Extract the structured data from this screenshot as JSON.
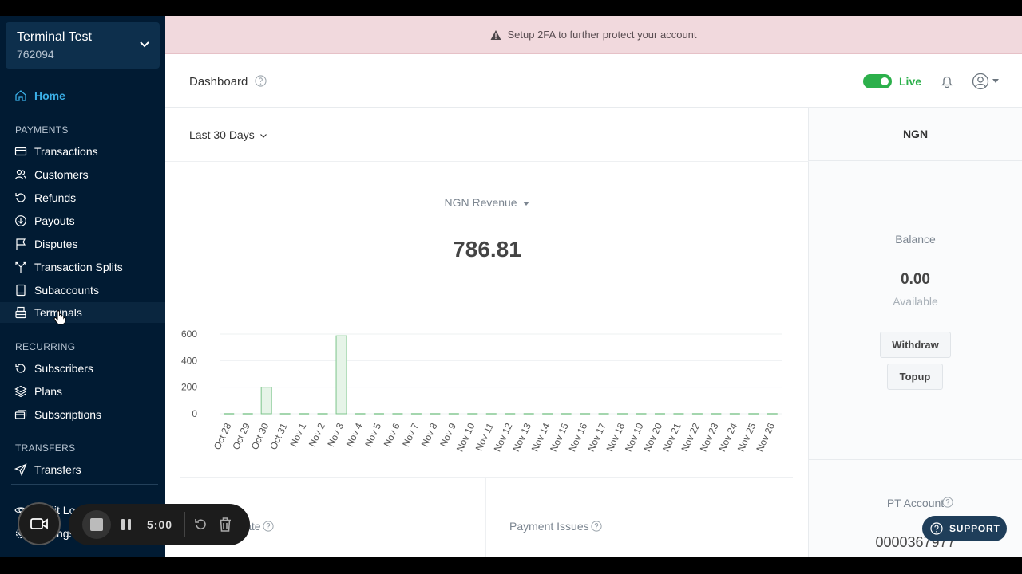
{
  "account": {
    "name": "Terminal Test",
    "id": "762094"
  },
  "sidebar": {
    "home": "Home",
    "payments_label": "PAYMENTS",
    "payments": [
      "Transactions",
      "Customers",
      "Refunds",
      "Payouts",
      "Disputes",
      "Transaction Splits",
      "Subaccounts",
      "Terminals"
    ],
    "recurring_label": "RECURRING",
    "recurring": [
      "Subscribers",
      "Plans",
      "Subscriptions"
    ],
    "transfers_label": "TRANSFERS",
    "transfers": [
      "Transfers"
    ],
    "bottom": [
      "Audit Logs",
      "Settings"
    ]
  },
  "banner": {
    "text": "Setup 2FA to further protect your account"
  },
  "header": {
    "title": "Dashboard",
    "live_label": "Live"
  },
  "main": {
    "range": "Last 30 Days",
    "revenue_label": "NGN Revenue",
    "revenue_value": "786.81",
    "bottom_left_label": "Date",
    "payment_issues": "Payment Issues"
  },
  "right": {
    "currency": "NGN",
    "balance_label": "Balance",
    "balance_value": "0.00",
    "available": "Available",
    "withdraw": "Withdraw",
    "topup": "Topup",
    "pt_account": "PT Account",
    "pt_number": "0000367977"
  },
  "support": "SUPPORT",
  "recorder": {
    "time": "5:00"
  },
  "colors": {
    "sidebar": "#011b33",
    "accent": "#3bb0e8",
    "live": "#2cb04b",
    "bar": "#2cb04b"
  },
  "chart_data": {
    "type": "bar",
    "title": "",
    "categories": [
      "Oct 28",
      "Oct 29",
      "Oct 30",
      "Oct 31",
      "Nov 1",
      "Nov 2",
      "Nov 3",
      "Nov 4",
      "Nov 5",
      "Nov 6",
      "Nov 7",
      "Nov 8",
      "Nov 9",
      "Nov 10",
      "Nov 11",
      "Nov 12",
      "Nov 13",
      "Nov 14",
      "Nov 15",
      "Nov 16",
      "Nov 17",
      "Nov 18",
      "Nov 19",
      "Nov 20",
      "Nov 21",
      "Nov 22",
      "Nov 23",
      "Nov 24",
      "Nov 25",
      "Nov 26"
    ],
    "values": [
      0,
      0,
      200,
      0,
      0,
      0,
      587,
      0,
      0,
      0,
      0,
      0,
      0,
      0,
      0,
      0,
      0,
      0,
      0,
      0,
      0,
      0,
      0,
      0,
      0,
      0,
      0,
      0,
      0,
      0
    ],
    "yticks": [
      0,
      200,
      400,
      600
    ],
    "ylim": [
      0,
      600
    ],
    "grid": true
  }
}
